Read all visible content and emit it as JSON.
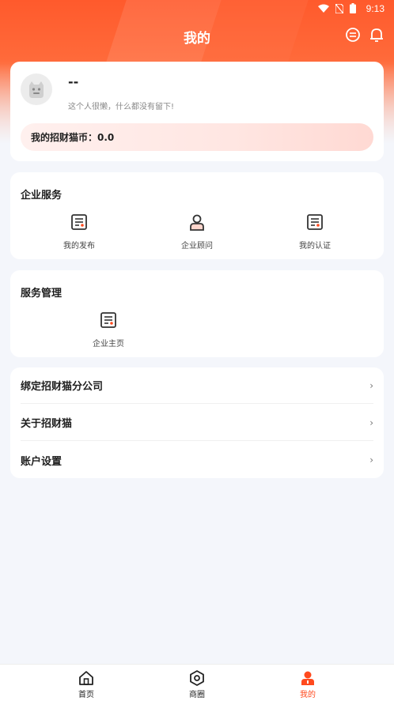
{
  "status_bar": {
    "time": "9:13"
  },
  "header": {
    "title": "我的"
  },
  "profile": {
    "nickname": "--",
    "bio": "这个人很懒，什么都没有留下!",
    "coin_label": "我的招财猫币：",
    "coin_value": "0.0"
  },
  "enterprise_services": {
    "title": "企业服务",
    "items": [
      {
        "label": "我的发布",
        "icon": "document-icon"
      },
      {
        "label": "企业顾问",
        "icon": "person-icon"
      },
      {
        "label": "我的认证",
        "icon": "document-icon"
      }
    ]
  },
  "service_management": {
    "title": "服务管理",
    "items": [
      {
        "label": "企业主页",
        "icon": "document-icon"
      }
    ]
  },
  "menu": {
    "items": [
      {
        "label": "绑定招财猫分公司"
      },
      {
        "label": "关于招财猫"
      },
      {
        "label": "账户设置"
      }
    ],
    "chevron": "›"
  },
  "bottom_nav": {
    "tabs": [
      {
        "label": "首页",
        "icon": "home-icon"
      },
      {
        "label": "商圈",
        "icon": "hexagon-icon"
      },
      {
        "label": "我的",
        "icon": "person-icon",
        "active": true
      }
    ],
    "active_color": "#ff4a1e"
  },
  "colors": {
    "accent": "#ff5a2c"
  }
}
